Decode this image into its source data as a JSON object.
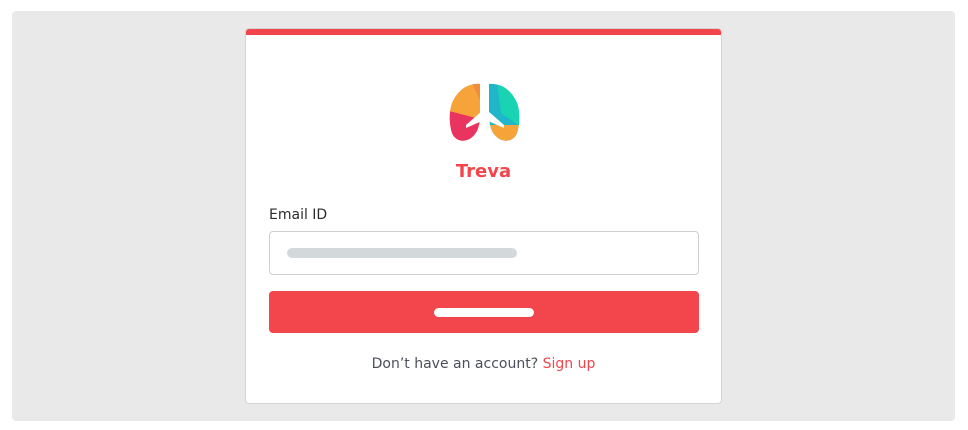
{
  "app": {
    "brand_name": "Treva",
    "logo_icon": "lungs-airplane-logo",
    "accent_color": "#f2464c"
  },
  "login_form": {
    "email_label": "Email ID",
    "email_value": "",
    "submit_label": ""
  },
  "footer": {
    "prompt_text": "Don’t have an account?",
    "signup_link": "Sign up"
  }
}
